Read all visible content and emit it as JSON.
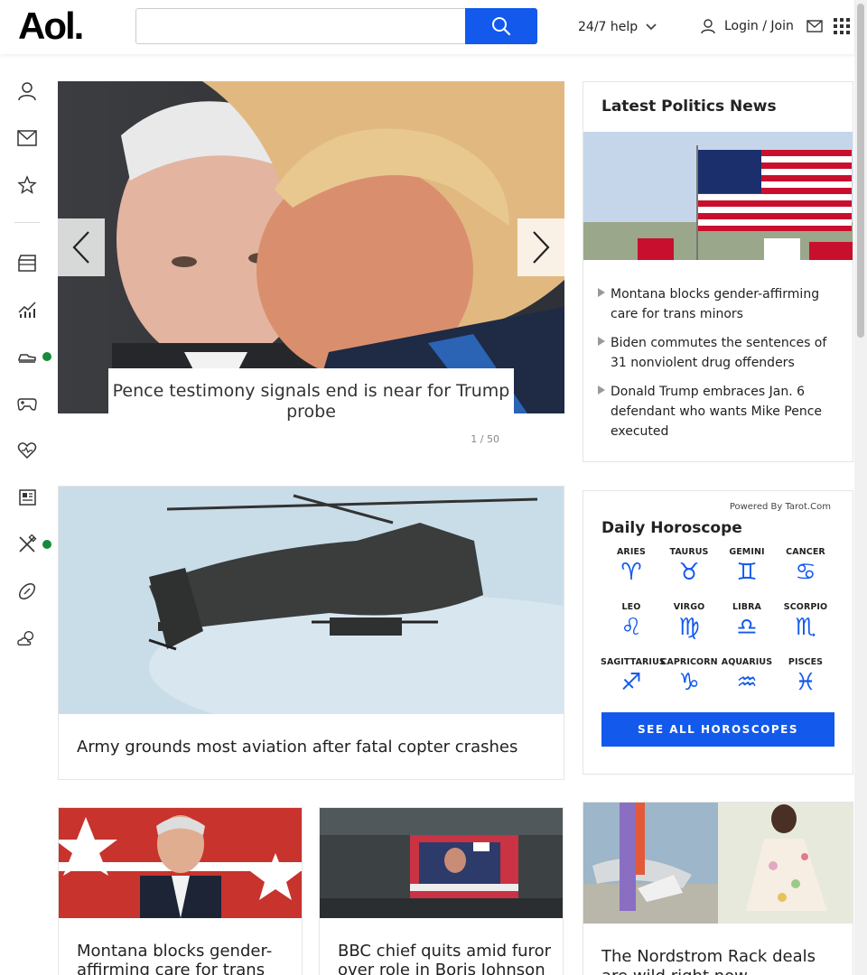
{
  "header": {
    "logo": "Aol.",
    "search_placeholder": "",
    "help_label": "24/7 help",
    "login_label": "Login / Join"
  },
  "colors": {
    "accent": "#1259ec",
    "status_dot": "#188a3c"
  },
  "left_nav": [
    "user-icon",
    "mail-icon",
    "star-icon",
    "entertainment-icon",
    "finance-icon",
    "shopping-icon",
    "games-icon",
    "health-icon",
    "news-icon",
    "lifestyle-icon",
    "sports-icon",
    "weather-icon"
  ],
  "carousel": {
    "caption": "Pence testimony signals end is near for Trump probe",
    "counter": "1 / 50"
  },
  "politics": {
    "heading": "Latest Politics News",
    "items": [
      "Montana blocks gender-affirming care for trans minors",
      "Biden commutes the sentences of 31 nonviolent drug offenders",
      "Donald Trump embraces Jan. 6 defendant who wants Mike Pence executed"
    ]
  },
  "army": {
    "title": "Army grounds most aviation after fatal copter crashes"
  },
  "horoscope": {
    "powered": "Powered By Tarot.Com",
    "heading": "Daily Horoscope",
    "signs": [
      {
        "name": "ARIES",
        "glyph": "♈"
      },
      {
        "name": "TAURUS",
        "glyph": "♉"
      },
      {
        "name": "GEMINI",
        "glyph": "♊"
      },
      {
        "name": "CANCER",
        "glyph": "♋"
      },
      {
        "name": "LEO",
        "glyph": "♌"
      },
      {
        "name": "VIRGO",
        "glyph": "♍"
      },
      {
        "name": "LIBRA",
        "glyph": "♎"
      },
      {
        "name": "SCORPIO",
        "glyph": "♏"
      },
      {
        "name": "SAGITTARIUS",
        "glyph": "♐"
      },
      {
        "name": "CAPRICORN",
        "glyph": "♑"
      },
      {
        "name": "AQUARIUS",
        "glyph": "♒"
      },
      {
        "name": "PISCES",
        "glyph": "♓"
      }
    ],
    "cta": "SEE ALL HOROSCOPES"
  },
  "cards": [
    {
      "title": "Montana blocks gender-affirming care for trans minors"
    },
    {
      "title": "BBC chief quits amid furor over role in Boris Johnson loan"
    }
  ],
  "nordstrom": {
    "title": "The Nordstrom Rack deals are wild right now"
  }
}
